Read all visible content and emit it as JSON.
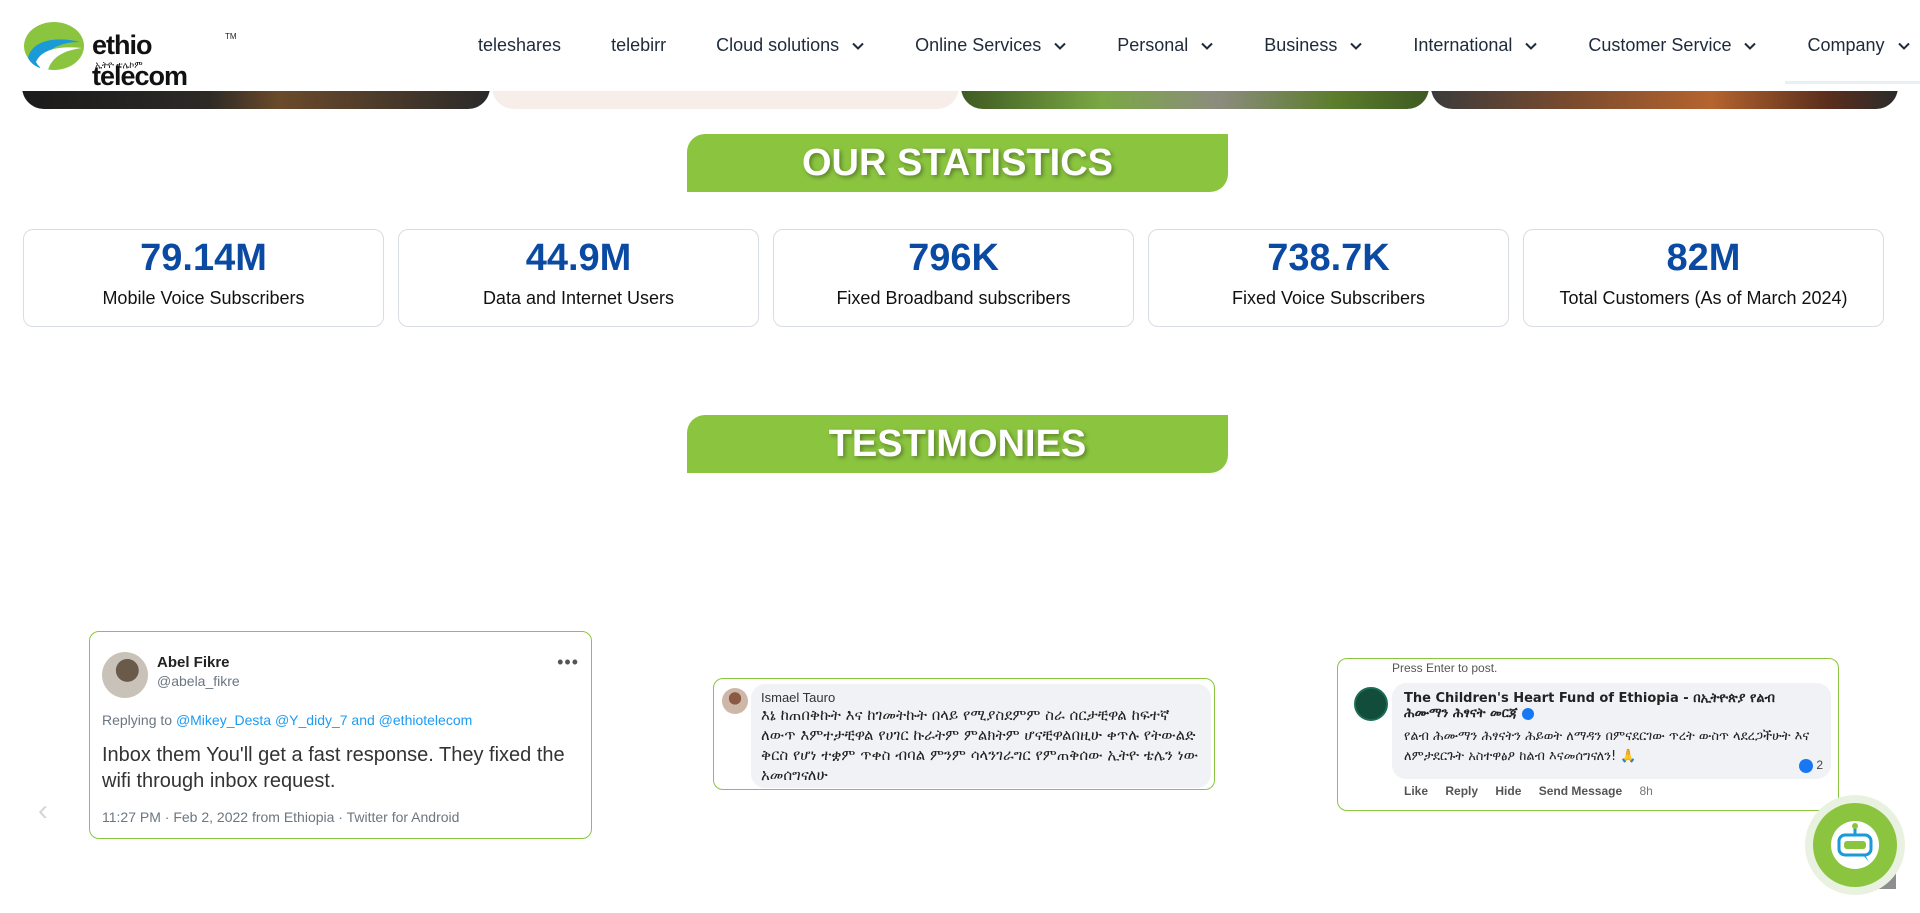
{
  "brand": {
    "name": "ethio telecom",
    "tm": "TM",
    "amharic": "ኢትዮ ቴሌኮም",
    "colors": {
      "green": "#8bc53f",
      "blue": "#0b4aa2"
    }
  },
  "nav": {
    "items": [
      {
        "label": "teleshares",
        "dropdown": false
      },
      {
        "label": "telebirr",
        "dropdown": false
      },
      {
        "label": "Cloud solutions",
        "dropdown": true
      },
      {
        "label": "Online Services",
        "dropdown": true
      },
      {
        "label": "Personal",
        "dropdown": true
      },
      {
        "label": "Business",
        "dropdown": true
      },
      {
        "label": "International",
        "dropdown": true
      },
      {
        "label": "Customer Service",
        "dropdown": true
      },
      {
        "label": "Company",
        "dropdown": true
      }
    ]
  },
  "statistics": {
    "title": "OUR STATISTICS",
    "cards": [
      {
        "value": "79.14M",
        "label": "Mobile Voice Subscribers"
      },
      {
        "value": "44.9M",
        "label": "Data and Internet Users"
      },
      {
        "value": "796K",
        "label": "Fixed Broadband subscribers"
      },
      {
        "value": "738.7K",
        "label": "Fixed Voice Subscribers"
      },
      {
        "value": "82M",
        "label": "Total Customers (As of March 2024)"
      }
    ]
  },
  "testimonies": {
    "title": "TESTIMONIES",
    "prev_icon": "chevron-left-icon",
    "tweet": {
      "name": "Abel Fikre",
      "handle": "@abela_fikre",
      "replying_prefix": "Replying to",
      "replying_to": "@Mikey_Desta @Y_didy_7 and @ethiotelecom",
      "body": "Inbox them You'll get a fast response. They fixed the wifi through inbox request.",
      "meta": "11:27 PM · Feb 2, 2022 from Ethiopia · Twitter for Android",
      "menu_icon": "more-dots-icon"
    },
    "comment": {
      "name": "Ismael Tauro",
      "body": "እኔ ከጠበቅኩት እና ከገመትኩት በላይ የሚያስደምም ስራ ሰርታቺዋል ከፍተኛ ለውጥ እምተታቺዋል የሀገር ኩራትም ምልክትም ሆናቺዋልበዚሁ ቀጥሉ የትውልድ ቅርስ የሆነ ተቋም ጥቀስ ብባል ምንም ሳላንገራግር የምጠቅሰው ኢትዮ ቴሌን ነው አመሰግናለሁ"
    },
    "facebook": {
      "hint": "Press Enter to post.",
      "name": "The Children's Heart Fund of Ethiopia - በኢትዮጵያ የልብ ሕሙማን ሕፃናት መርጃ",
      "body": "የልብ ሕሙማን ሕፃናትን ሕይወት ለማዳን በምናደርገው ጥረት ውስጥ ላደረጋችሁት እና ለምታደርጉት አስተዋፅዖ ከልብ እናመሰግናለን! 🙏",
      "reactions": "2",
      "actions": [
        "Like",
        "Reply",
        "Hide",
        "Send Message"
      ],
      "time": "8h"
    }
  },
  "chatbot": {
    "icon": "chatbot-icon"
  }
}
